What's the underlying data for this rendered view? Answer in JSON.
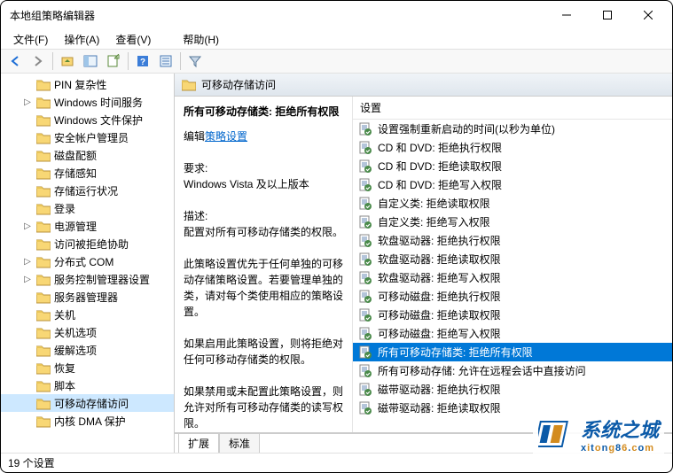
{
  "window": {
    "title": "本地组策略编辑器"
  },
  "menu": [
    "文件(F)",
    "操作(A)",
    "查看(V)",
    "帮助(H)"
  ],
  "tree": [
    {
      "label": "PIN 复杂性",
      "indent": 24,
      "expander": ""
    },
    {
      "label": "Windows 时间服务",
      "indent": 24,
      "expander": "▷"
    },
    {
      "label": "Windows 文件保护",
      "indent": 24,
      "expander": ""
    },
    {
      "label": "安全帐户管理员",
      "indent": 24,
      "expander": ""
    },
    {
      "label": "磁盘配额",
      "indent": 24,
      "expander": ""
    },
    {
      "label": "存储感知",
      "indent": 24,
      "expander": ""
    },
    {
      "label": "存储运行状况",
      "indent": 24,
      "expander": ""
    },
    {
      "label": "登录",
      "indent": 24,
      "expander": ""
    },
    {
      "label": "电源管理",
      "indent": 24,
      "expander": "▷"
    },
    {
      "label": "访问被拒绝协助",
      "indent": 24,
      "expander": ""
    },
    {
      "label": "分布式 COM",
      "indent": 24,
      "expander": "▷"
    },
    {
      "label": "服务控制管理器设置",
      "indent": 24,
      "expander": "▷"
    },
    {
      "label": "服务器管理器",
      "indent": 24,
      "expander": ""
    },
    {
      "label": "关机",
      "indent": 24,
      "expander": ""
    },
    {
      "label": "关机选项",
      "indent": 24,
      "expander": ""
    },
    {
      "label": "缓解选项",
      "indent": 24,
      "expander": ""
    },
    {
      "label": "恢复",
      "indent": 24,
      "expander": ""
    },
    {
      "label": "脚本",
      "indent": 24,
      "expander": ""
    },
    {
      "label": "可移动存储访问",
      "indent": 24,
      "expander": "",
      "selected": true
    },
    {
      "label": "内核 DMA 保护",
      "indent": 24,
      "expander": ""
    }
  ],
  "header": {
    "title": "可移动存储访问"
  },
  "detail": {
    "policy_title": "所有可移动存储类: 拒绝所有权限",
    "edit_label_prefix": "编辑",
    "edit_link": "策略设置",
    "req_label": "要求:",
    "req_value": "Windows Vista 及以上版本",
    "desc_label": "描述:",
    "desc_value": "配置对所有可移动存储类的权限。",
    "para1": "此策略设置优先于任何单独的可移动存储策略设置。若要管理单独的类，请对每个类使用相应的策略设置。",
    "para2": "如果启用此策略设置，则将拒绝对任何可移动存储类的权限。",
    "para3": "如果禁用或未配置此策略设置，则允许对所有可移动存储类的读写权限。"
  },
  "list_header": "设置",
  "list": [
    "设置强制重新启动的时间(以秒为单位)",
    "CD 和 DVD: 拒绝执行权限",
    "CD 和 DVD: 拒绝读取权限",
    "CD 和 DVD: 拒绝写入权限",
    "自定义类: 拒绝读取权限",
    "自定义类: 拒绝写入权限",
    "软盘驱动器: 拒绝执行权限",
    "软盘驱动器: 拒绝读取权限",
    "软盘驱动器: 拒绝写入权限",
    "可移动磁盘: 拒绝执行权限",
    "可移动磁盘: 拒绝读取权限",
    "可移动磁盘: 拒绝写入权限",
    "所有可移动存储类: 拒绝所有权限",
    "所有可移动存储: 允许在远程会话中直接访问",
    "磁带驱动器: 拒绝执行权限",
    "磁带驱动器: 拒绝读取权限"
  ],
  "list_selected_index": 12,
  "tabs": [
    "扩展",
    "标准"
  ],
  "tab_active_index": 0,
  "status": "19 个设置",
  "watermark": {
    "cn": "系统之城",
    "en_parts": [
      "x",
      "i",
      "t",
      "o",
      "n",
      "g",
      "8",
      "6",
      ".",
      "c",
      "o",
      "m"
    ]
  }
}
